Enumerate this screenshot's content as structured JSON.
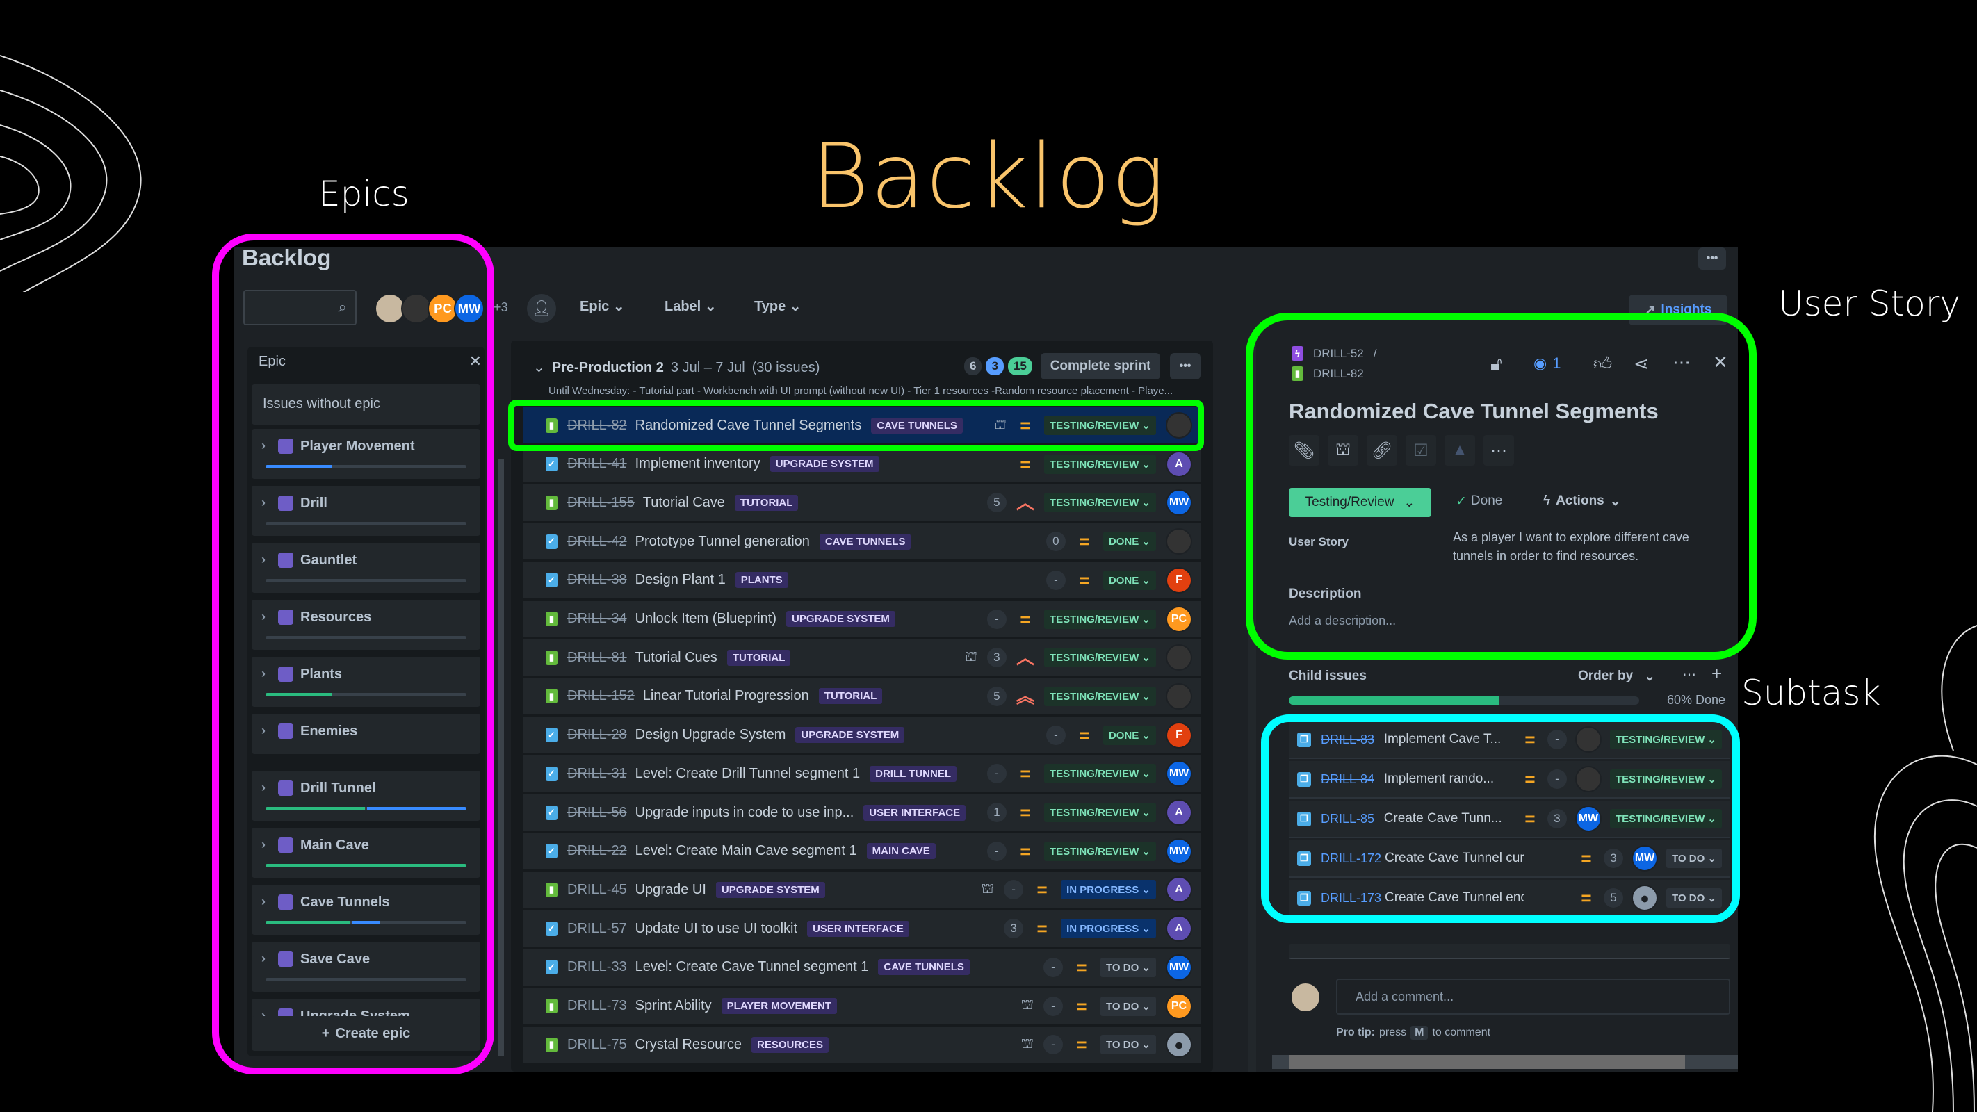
{
  "slide": {
    "title": "Backlog",
    "annotations": {
      "epics": "Epics",
      "user_story": "User Story",
      "subtask": "Subtask"
    },
    "highlight_colors": {
      "epics": "#ff00ff",
      "user_story": "#00ff00",
      "subtask": "#00ffff"
    }
  },
  "header": {
    "title": "Backlog",
    "search_placeholder": "",
    "avatars": [
      {
        "initials": "",
        "color": "#c8b8a0",
        "kind": "photo"
      },
      {
        "initials": "",
        "color": "#333333",
        "kind": "photo"
      },
      {
        "initials": "PC",
        "color": "#ff991f"
      },
      {
        "initials": "MW",
        "color": "#0c66e4"
      }
    ],
    "avatars_more": "+3",
    "filters": [
      "Epic",
      "Label",
      "Type"
    ],
    "insights_label": "Insights",
    "more_label": "•••"
  },
  "epic_panel": {
    "header": "Epic",
    "close": "✕",
    "issues_without_epic": "Issues without epic",
    "create_label": "Create epic",
    "epics": [
      {
        "name": "Player Movement",
        "done": 0,
        "in_progress": 0.33,
        "bar": true
      },
      {
        "name": "Drill",
        "done": 0,
        "in_progress": 0,
        "bar": true
      },
      {
        "name": "Gauntlet",
        "done": 0,
        "in_progress": 0,
        "bar": true
      },
      {
        "name": "Resources",
        "done": 0,
        "in_progress": 0,
        "bar": true
      },
      {
        "name": "Plants",
        "done": 0.33,
        "in_progress": 0,
        "bar": true
      },
      {
        "name": "Enemies",
        "done": 0,
        "in_progress": 0,
        "bar": false
      },
      {
        "name": "Drill Tunnel",
        "done": 0.5,
        "in_progress": 0.5,
        "bar": true
      },
      {
        "name": "Main Cave",
        "done": 1,
        "in_progress": 0,
        "bar": true
      },
      {
        "name": "Cave Tunnels",
        "done": 0.42,
        "in_progress": 0.14,
        "bar": true
      },
      {
        "name": "Save Cave",
        "done": 0,
        "in_progress": 0,
        "bar": true
      },
      {
        "name": "Upgrade System",
        "done": 0,
        "in_progress": 0,
        "bar": true
      }
    ]
  },
  "sprint": {
    "name": "Pre-Production 2",
    "dates": "3 Jul – 7 Jul",
    "count": "(30 issues)",
    "counts": {
      "todo": "6",
      "in_progress": "3",
      "done": "15"
    },
    "complete_label": "Complete sprint",
    "goal": "Until Wednesday: - Tutorial part - Workbench with UI prompt (without new UI) - Tier 1 resources -Random resource placement - Playe...",
    "issues": [
      {
        "key": "DRILL-82",
        "title": "Randomized Cave Tunnel Segments",
        "label": "CAVE TUNNELS",
        "type": "story",
        "done": true,
        "child": true,
        "estimate": "",
        "priority": "medium",
        "status": "TESTING/REVIEW",
        "assignee": {
          "initials": "",
          "color": "#333333"
        },
        "selected": true
      },
      {
        "key": "DRILL-41",
        "title": "Implement inventory",
        "label": "UPGRADE SYSTEM",
        "type": "task",
        "done": true,
        "child": false,
        "estimate": "",
        "priority": "medium",
        "status": "TESTING/REVIEW",
        "assignee": {
          "initials": "A",
          "color": "#5e4db2"
        }
      },
      {
        "key": "DRILL-155",
        "title": "Tutorial Cave",
        "label": "TUTORIAL",
        "type": "story",
        "done": true,
        "child": false,
        "estimate": "5",
        "priority": "high",
        "status": "TESTING/REVIEW",
        "assignee": {
          "initials": "MW",
          "color": "#0c66e4"
        }
      },
      {
        "key": "DRILL-42",
        "title": "Prototype Tunnel generation",
        "label": "CAVE TUNNELS",
        "type": "task",
        "done": true,
        "child": false,
        "estimate": "0",
        "priority": "medium",
        "status": "DONE",
        "assignee": {
          "initials": "",
          "color": "#333333"
        }
      },
      {
        "key": "DRILL-38",
        "title": "Design Plant 1",
        "label": "PLANTS",
        "type": "task",
        "done": true,
        "child": false,
        "estimate": "-",
        "priority": "medium",
        "status": "DONE",
        "assignee": {
          "initials": "F",
          "color": "#e2400f"
        }
      },
      {
        "key": "DRILL-34",
        "title": "Unlock Item (Blueprint)",
        "label": "UPGRADE SYSTEM",
        "type": "story",
        "done": true,
        "child": false,
        "estimate": "-",
        "priority": "medium",
        "status": "TESTING/REVIEW",
        "assignee": {
          "initials": "PC",
          "color": "#ff991f"
        }
      },
      {
        "key": "DRILL-81",
        "title": "Tutorial Cues",
        "label": "TUTORIAL",
        "type": "story",
        "done": true,
        "child": true,
        "estimate": "3",
        "priority": "high",
        "status": "TESTING/REVIEW",
        "assignee": {
          "initials": "",
          "color": "#333333"
        }
      },
      {
        "key": "DRILL-152",
        "title": "Linear Tutorial Progression",
        "label": "TUTORIAL",
        "type": "story",
        "done": true,
        "child": false,
        "estimate": "5",
        "priority": "highest",
        "status": "TESTING/REVIEW",
        "assignee": {
          "initials": "",
          "color": "#333333"
        }
      },
      {
        "key": "DRILL-28",
        "title": "Design Upgrade System",
        "label": "UPGRADE SYSTEM",
        "type": "task",
        "done": true,
        "child": false,
        "estimate": "-",
        "priority": "medium",
        "status": "DONE",
        "assignee": {
          "initials": "F",
          "color": "#e2400f"
        }
      },
      {
        "key": "DRILL-31",
        "title": "Level: Create Drill Tunnel segment 1",
        "label": "DRILL TUNNEL",
        "type": "task",
        "done": true,
        "child": false,
        "estimate": "-",
        "priority": "medium",
        "status": "TESTING/REVIEW",
        "assignee": {
          "initials": "MW",
          "color": "#0c66e4"
        }
      },
      {
        "key": "DRILL-56",
        "title": "Upgrade inputs in code to use inp...",
        "label": "USER INTERFACE",
        "type": "task",
        "done": true,
        "child": false,
        "estimate": "1",
        "priority": "medium",
        "status": "TESTING/REVIEW",
        "assignee": {
          "initials": "A",
          "color": "#5e4db2"
        }
      },
      {
        "key": "DRILL-22",
        "title": "Level: Create Main Cave segment 1",
        "label": "MAIN CAVE",
        "type": "task",
        "done": true,
        "child": false,
        "estimate": "-",
        "priority": "medium",
        "status": "TESTING/REVIEW",
        "assignee": {
          "initials": "MW",
          "color": "#0c66e4"
        }
      },
      {
        "key": "DRILL-45",
        "title": "Upgrade UI",
        "label": "UPGRADE SYSTEM",
        "type": "story",
        "done": false,
        "child": true,
        "estimate": "-",
        "priority": "medium",
        "status": "IN PROGRESS",
        "assignee": {
          "initials": "A",
          "color": "#5e4db2"
        }
      },
      {
        "key": "DRILL-57",
        "title": "Update UI to use UI toolkit",
        "label": "USER INTERFACE",
        "type": "task",
        "done": false,
        "child": false,
        "estimate": "3",
        "priority": "medium",
        "status": "IN PROGRESS",
        "assignee": {
          "initials": "A",
          "color": "#5e4db2"
        }
      },
      {
        "key": "DRILL-33",
        "title": "Level: Create Cave Tunnel segment 1",
        "label": "CAVE TUNNELS",
        "type": "task",
        "done": false,
        "child": false,
        "estimate": "-",
        "priority": "medium",
        "status": "TO DO",
        "assignee": {
          "initials": "MW",
          "color": "#0c66e4"
        }
      },
      {
        "key": "DRILL-73",
        "title": "Sprint Ability",
        "label": "PLAYER MOVEMENT",
        "type": "story",
        "done": false,
        "child": true,
        "estimate": "-",
        "priority": "medium",
        "status": "TO DO",
        "assignee": {
          "initials": "PC",
          "color": "#ff991f"
        }
      },
      {
        "key": "DRILL-75",
        "title": "Crystal Resource",
        "label": "RESOURCES",
        "type": "story",
        "done": false,
        "child": true,
        "estimate": "-",
        "priority": "medium",
        "status": "TO DO",
        "assignee": {
          "initials": "",
          "color": "#8c9bab",
          "kind": "default"
        }
      }
    ]
  },
  "detail": {
    "parent_key": "DRILL-52",
    "separator": "/",
    "key": "DRILL-82",
    "watchers": "1",
    "title": "Randomized Cave Tunnel Segments",
    "status_button": "Testing/Review",
    "done_label": "Done",
    "actions_label": "Actions",
    "user_story_label": "User Story",
    "user_story_value": "As a player I want to explore different cave tunnels in order to find resources.",
    "description_label": "Description",
    "description_placeholder": "Add a description...",
    "child_issues_label": "Child issues",
    "order_by_label": "Order by",
    "progress": 0.6,
    "progress_label": "60% Done",
    "children": [
      {
        "key": "DRILL-83",
        "title": "Implement Cave T...",
        "done": true,
        "estimate": "-",
        "status": "TESTING/REVIEW",
        "assignee": {
          "initials": "",
          "color": "#333333"
        }
      },
      {
        "key": "DRILL-84",
        "title": "Implement rando...",
        "done": true,
        "estimate": "-",
        "status": "TESTING/REVIEW",
        "assignee": {
          "initials": "",
          "color": "#333333"
        }
      },
      {
        "key": "DRILL-85",
        "title": "Create Cave Tunn...",
        "done": true,
        "estimate": "3",
        "status": "TESTING/REVIEW",
        "assignee": {
          "initials": "MW",
          "color": "#0c66e4"
        }
      },
      {
        "key": "DRILL-172",
        "title": "Create Cave Tunnel curve r...",
        "done": false,
        "estimate": "3",
        "status": "TO DO",
        "assignee": {
          "initials": "MW",
          "color": "#0c66e4"
        }
      },
      {
        "key": "DRILL-173",
        "title": "Create Cave Tunnel end pi...",
        "done": false,
        "estimate": "5",
        "status": "TO DO",
        "assignee": {
          "initials": "",
          "color": "#8c9bab",
          "kind": "default"
        }
      }
    ],
    "comment_placeholder": "Add a comment...",
    "pro_tip_bold": "Pro tip:",
    "pro_tip_press": "press",
    "pro_tip_key": "M",
    "pro_tip_rest": "to comment"
  }
}
